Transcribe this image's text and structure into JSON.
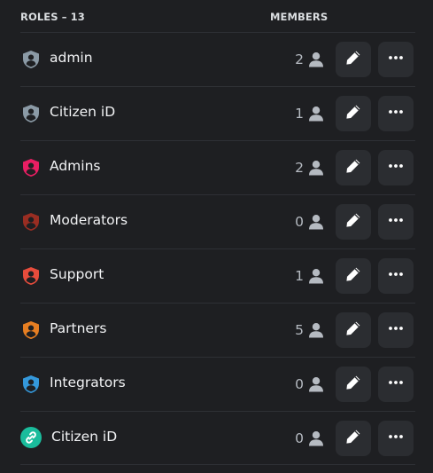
{
  "header": {
    "roles_label": "ROLES – 13",
    "members_label": "MEMBERS"
  },
  "roles": [
    {
      "name": "admin",
      "members": "2",
      "color": "#8b9aa6",
      "icon": "shield-person-icon"
    },
    {
      "name": "Citizen iD",
      "members": "1",
      "color": "#8b9aa6",
      "icon": "shield-person-icon"
    },
    {
      "name": "Admins",
      "members": "2",
      "color": "#e91e63",
      "icon": "shield-person-icon"
    },
    {
      "name": "Moderators",
      "members": "0",
      "color": "#992d22",
      "icon": "shield-person-icon"
    },
    {
      "name": "Support",
      "members": "1",
      "color": "#e74c3c",
      "icon": "shield-person-icon"
    },
    {
      "name": "Partners",
      "members": "5",
      "color": "#e67e22",
      "icon": "shield-person-icon"
    },
    {
      "name": "Integrators",
      "members": "0",
      "color": "#3498db",
      "icon": "shield-person-icon"
    },
    {
      "name": "Citizen iD",
      "members": "0",
      "color": "#1abc9c",
      "icon": "link-icon"
    }
  ],
  "colors": {
    "background": "#1e1f22",
    "button": "#2b2d31",
    "text": "#f2f3f5",
    "muted": "#b5bac1"
  }
}
